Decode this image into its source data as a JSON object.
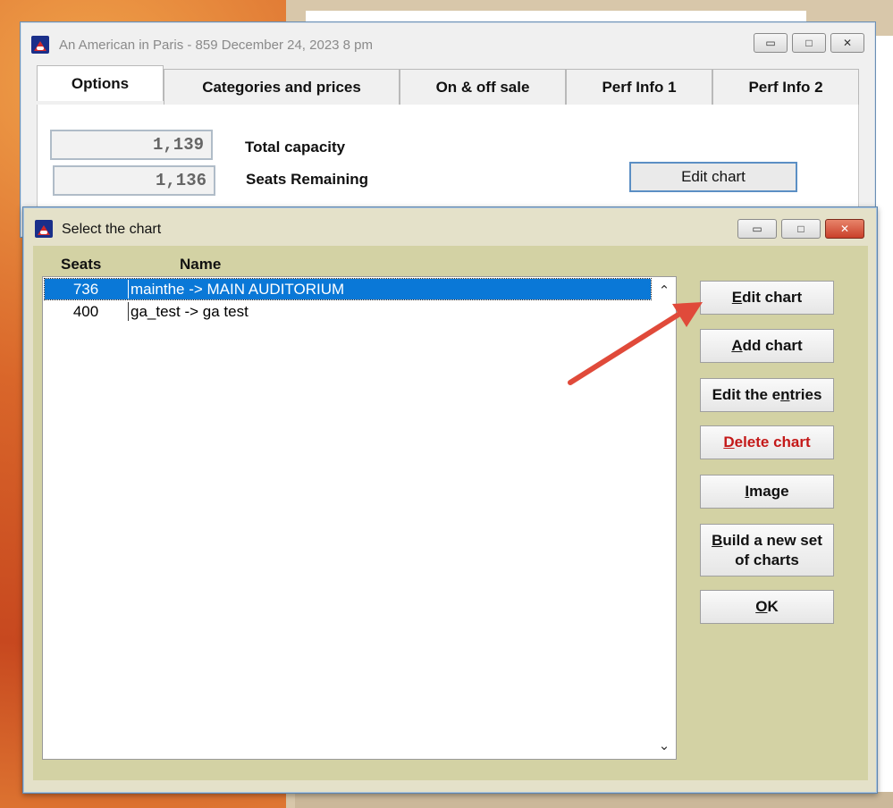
{
  "back_window": {
    "title": "An American in Paris - 859 December 24, 2023 8 pm",
    "tabs": [
      "Options",
      "Categories and prices",
      "On & off sale",
      "Perf Info 1",
      "Perf Info 2"
    ],
    "total_capacity_value": "1,139",
    "total_capacity_label": "Total capacity",
    "seats_remaining_value": "1,136",
    "seats_remaining_label": "Seats Remaining",
    "edit_chart_label": "Edit chart"
  },
  "dialog": {
    "title": "Select the chart",
    "columns": {
      "seats": "Seats",
      "name": "Name"
    },
    "rows": [
      {
        "seats": "736",
        "name": "mainthe -> MAIN AUDITORIUM",
        "selected": true
      },
      {
        "seats": "400",
        "name": "ga_test -> ga test",
        "selected": false
      }
    ],
    "buttons": {
      "edit_chart": {
        "accel": "E",
        "rest": "dit chart"
      },
      "add_chart": {
        "accel": "A",
        "rest": "dd chart"
      },
      "edit_entries": {
        "pre": "Edit the e",
        "accel": "n",
        "rest": "tries"
      },
      "delete_chart": {
        "accel": "D",
        "rest": "elete chart"
      },
      "image": {
        "accel": "I",
        "rest": "mage"
      },
      "build_set": {
        "accel": "B",
        "rest": "uild a new set",
        "line2": "of charts"
      },
      "ok": {
        "accel": "O",
        "rest": "K"
      }
    }
  },
  "colors": {
    "selection": "#0a78d7",
    "dialog_client": "#d3d2a4",
    "delete_text": "#c41919",
    "annotation_arrow": "#e04a3a"
  },
  "icons": {
    "window_controls": [
      "minimize-icon",
      "maximize-icon",
      "close-icon"
    ],
    "scroll": [
      "chevron-up-icon",
      "chevron-down-icon"
    ],
    "app": "theater-app-icon"
  }
}
